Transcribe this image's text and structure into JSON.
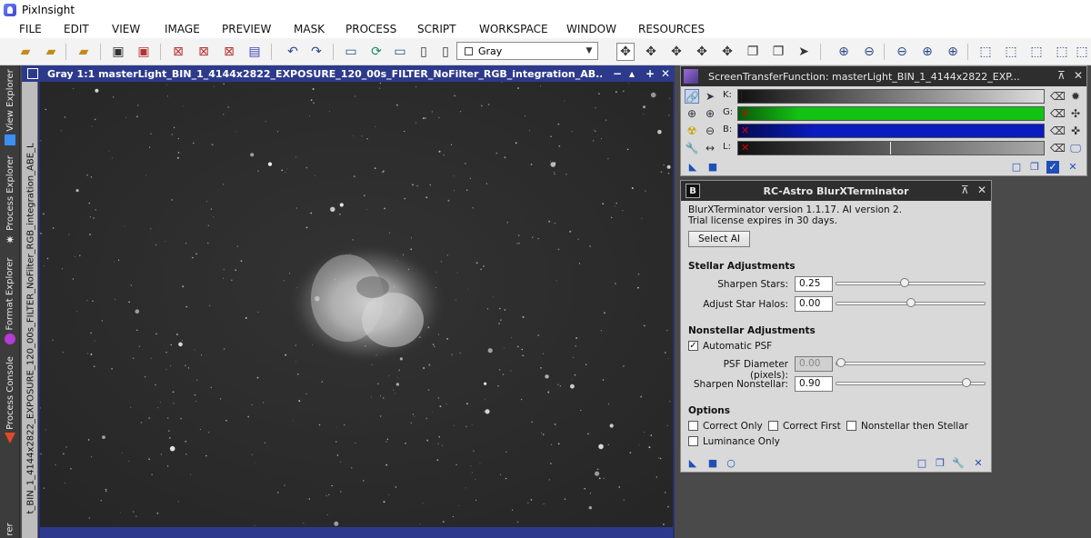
{
  "app_title": "PixInsight",
  "menu": [
    "FILE",
    "EDIT",
    "VIEW",
    "IMAGE",
    "PREVIEW",
    "MASK",
    "PROCESS",
    "SCRIPT",
    "WORKSPACE",
    "WINDOW",
    "RESOURCES"
  ],
  "toolbar": {
    "view_selector": "Gray"
  },
  "left_tabs": [
    "View Explorer",
    "Process Explorer",
    "Format Explorer",
    "Process Console",
    "rer"
  ],
  "image_window": {
    "title": "Gray 1:1 masterLight_BIN_1_4144x2822_EXPOSURE_120_00s_FILTER_NoFilter_RGB_integration_AB...",
    "side_label": "t_BIN_1_4144x2822_EXPOSURE_120_00s_FILTER_NoFilter_RGB_integration_ABE_L"
  },
  "stf": {
    "title": "ScreenTransferFunction: masterLight_BIN_1_4144x2822_EXP...",
    "channels": [
      {
        "label": "K:",
        "color": "#1a1a1a"
      },
      {
        "label": "G:",
        "color": "#13c313"
      },
      {
        "label": "B:",
        "color": "#0a1bc0"
      },
      {
        "label": "L:",
        "color": "#1a1a1a"
      }
    ]
  },
  "bxt": {
    "title": "RC-Astro BlurXTerminator",
    "version_line": "BlurXTerminator version 1.1.17. AI version 2.",
    "license_line": "Trial license expires in 30 days.",
    "select_ai": "Select AI",
    "stellar_header": "Stellar Adjustments",
    "sharpen_stars_label": "Sharpen Stars:",
    "sharpen_stars_value": "0.25",
    "sharpen_stars_level": 0.46,
    "halos_label": "Adjust Star Halos:",
    "halos_value": "0.00",
    "halos_level": 0.5,
    "nonstellar_header": "Nonstellar Adjustments",
    "auto_psf_label": "Automatic PSF",
    "auto_psf_checked": true,
    "psf_label": "PSF Diameter (pixels):",
    "psf_value": "0.00",
    "psf_level": 0.0,
    "sharpen_ns_label": "Sharpen Nonstellar:",
    "sharpen_ns_value": "0.90",
    "sharpen_ns_level": 0.9,
    "options_header": "Options",
    "correct_only": "Correct Only",
    "correct_first": "Correct First",
    "nonstellar_then_stellar": "Nonstellar then Stellar",
    "luminance_only": "Luminance Only"
  }
}
